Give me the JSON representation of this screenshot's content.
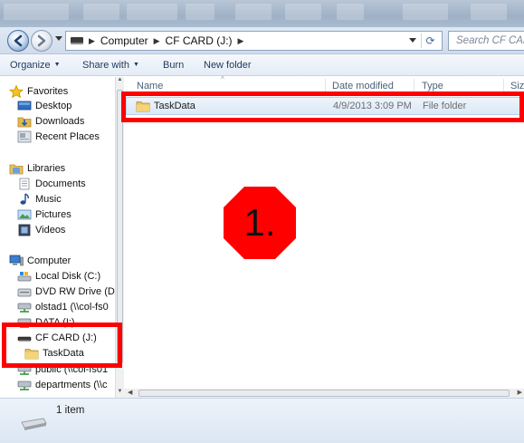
{
  "window": {
    "breadcrumb": [
      "Computer",
      "CF CARD (J:)"
    ],
    "search_placeholder": "Search CF CARD (J:)"
  },
  "toolbar": {
    "organize_label": "Organize",
    "share_label": "Share with",
    "burn_label": "Burn",
    "new_folder_label": "New folder"
  },
  "sidebar": {
    "favorites": {
      "label": "Favorites",
      "items": [
        "Desktop",
        "Downloads",
        "Recent Places"
      ]
    },
    "libraries": {
      "label": "Libraries",
      "items": [
        "Documents",
        "Music",
        "Pictures",
        "Videos"
      ]
    },
    "computer": {
      "label": "Computer",
      "items": [
        "Local Disk (C:)",
        "DVD RW Drive (D",
        "olstad1 (\\\\col-fs0",
        "DATA (I:)",
        "CF CARD (J:)",
        "TaskData",
        "public (\\\\col-fs01",
        "departments (\\\\c"
      ]
    }
  },
  "file_list": {
    "columns": [
      "Name",
      "Date modified",
      "Type",
      "Size"
    ],
    "rows": [
      {
        "name": "TaskData",
        "date_modified": "4/9/2013 3:09 PM",
        "type": "File folder"
      }
    ]
  },
  "status": {
    "item_count": "1 item"
  },
  "annotation": {
    "step_label": "1.",
    "highlight_color": "#ff0000",
    "marker_color": "#ff0000"
  },
  "icons": [
    "back-arrow-icon",
    "forward-arrow-icon",
    "refresh-icon",
    "star-icon",
    "folder-icon",
    "drive-icon",
    "network-drive-icon",
    "library-icon",
    "computer-icon"
  ]
}
